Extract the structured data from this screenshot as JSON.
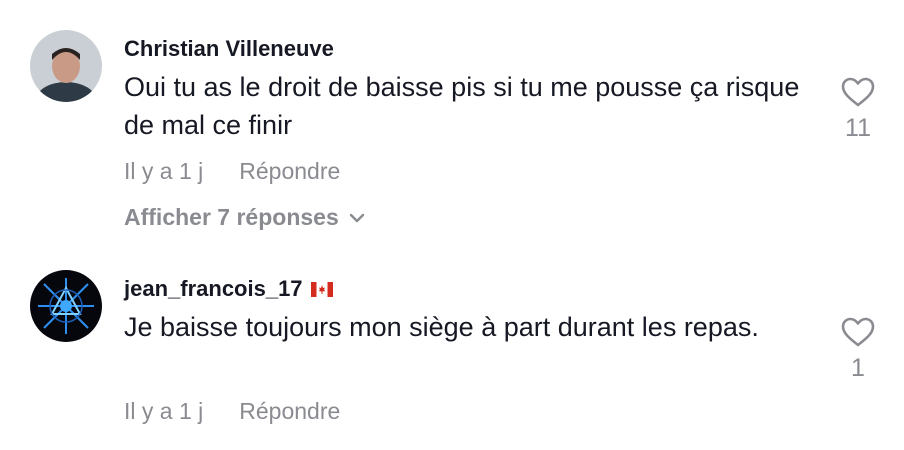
{
  "comments": [
    {
      "username": "Christian Villeneuve",
      "text": "Oui tu as le droit de baisse pis si tu me pousse ça risque de mal ce finir",
      "time": "Il y a 1 j",
      "reply_label": "Répondre",
      "like_count": "11",
      "view_replies_label": "Afficher 7 réponses",
      "avatar_icon": "avatar-photo"
    },
    {
      "username": "jean_francois_17",
      "badge_icon": "canada-flag-icon",
      "text": "Je baisse toujours mon siège à part durant les repas.",
      "time": "Il y a 1 j",
      "reply_label": "Répondre",
      "like_count": "1",
      "avatar_icon": "avatar-photo"
    }
  ],
  "colors": {
    "primary_text": "#161823",
    "secondary_text": "#8a8b91",
    "flag_red": "#d52b1e"
  }
}
